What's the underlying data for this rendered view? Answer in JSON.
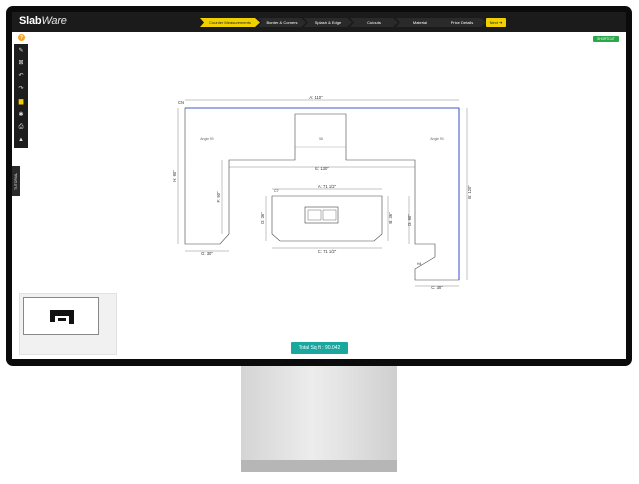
{
  "app": {
    "logo_main": "Slab",
    "logo_sub": "Ware"
  },
  "steps": [
    {
      "label": "Counter Measurements",
      "active": true
    },
    {
      "label": "Border & Corners",
      "active": false
    },
    {
      "label": "Splash & Edge",
      "active": false
    },
    {
      "label": "Cutouts",
      "active": false
    },
    {
      "label": "Material",
      "active": false
    },
    {
      "label": "Price Details",
      "active": false
    }
  ],
  "next_label": "Next",
  "help_glyph": "?",
  "shortcut_label": "SHORTCUT",
  "sidetab_label": "TUTORIAL",
  "tools": [
    {
      "icon": "pencil-icon",
      "glyph": "✎"
    },
    {
      "icon": "crop-icon",
      "glyph": "⊠"
    },
    {
      "icon": "undo-icon",
      "glyph": "↶"
    },
    {
      "icon": "redo-icon",
      "glyph": "↷"
    },
    {
      "icon": "folder-icon",
      "glyph": "▆"
    },
    {
      "icon": "settings-icon",
      "glyph": "✱"
    },
    {
      "icon": "print-icon",
      "glyph": "⎙"
    },
    {
      "icon": "warning-icon",
      "glyph": "▲"
    }
  ],
  "total_label": "Total Sq ft : 90.042",
  "drawing": {
    "top_dim": "A: 110\"",
    "top_corner": "CN",
    "angle_left": "Angle 90",
    "angle_right": "Angle 90",
    "peninsula_mid": "58",
    "inner_dim": "E: 130\"",
    "left_side": "H: 90\"",
    "left_inner": "F: 90\"",
    "left_bottom": "G: 30\"",
    "right_side": "B: 120\"",
    "right_inner": "D: 90\"",
    "right_bottom": "C: 30\"",
    "right_label": "H4",
    "island_top": "A: 71 1/2\"",
    "island_corner": "C7",
    "island_left": "D: 36\"",
    "island_right": "B: 36\"",
    "island_bottom": "C: 71 1/2\""
  },
  "colors": {
    "accent": "#f1d000",
    "success": "#2aa84a",
    "teal": "#1aa7a0",
    "edge_highlight": "#2b3bd6"
  }
}
